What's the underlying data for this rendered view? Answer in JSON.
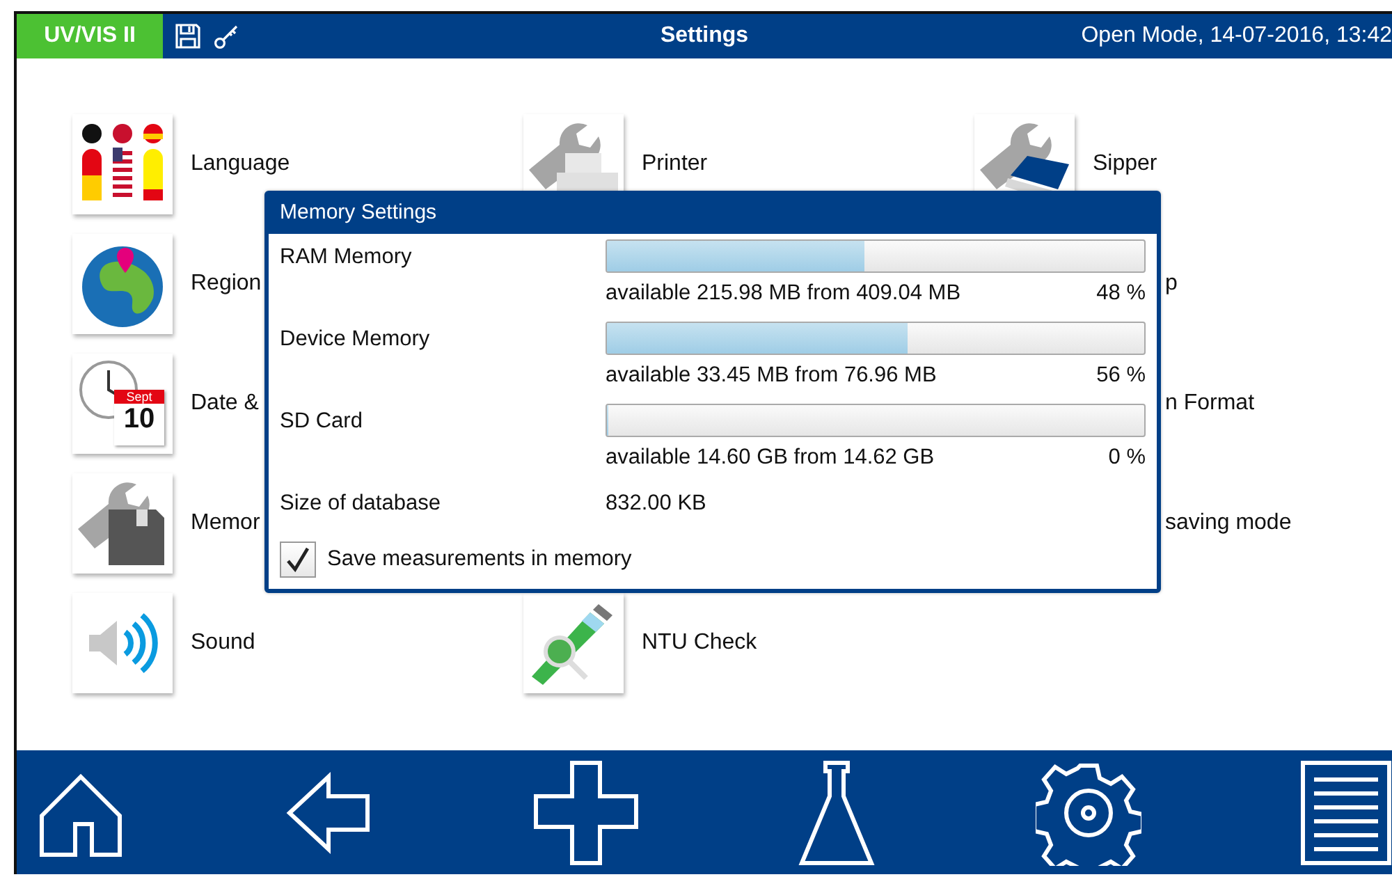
{
  "header": {
    "product": "UV/VIS II",
    "title": "Settings",
    "status": "Open Mode, 14-07-2016, 13:42"
  },
  "rows": [
    [
      {
        "label": "Language",
        "kind": "language"
      },
      {
        "label": "Printer",
        "kind": "printer"
      },
      {
        "label": "Sipper",
        "kind": "sipper"
      }
    ],
    [
      {
        "label": "Region",
        "kind": "globe"
      },
      null,
      {
        "label": "p"
      }
    ],
    [
      {
        "label": "Date &",
        "kind": "calendar",
        "calendar_month": "Sept",
        "calendar_day": "10"
      },
      null,
      {
        "label": "n Format"
      }
    ],
    [
      {
        "label": "Memor",
        "kind": "memory"
      },
      null,
      {
        "label": "saving mode"
      }
    ],
    [
      {
        "label": "Sound",
        "kind": "sound"
      },
      {
        "label": "NTU Check",
        "kind": "ntu"
      },
      null
    ]
  ],
  "dialog": {
    "title": "Memory Settings",
    "memories": [
      {
        "label": "RAM Memory",
        "level": 0.48,
        "available": "available 215.98 MB from 409.04 MB",
        "percent": "48 %"
      },
      {
        "label": "Device Memory",
        "level": 0.56,
        "available": "available 33.45 MB from 76.96 MB",
        "percent": "56 %"
      },
      {
        "label": "SD Card",
        "level": 0.0,
        "available": "available 14.60 GB from 14.62 GB",
        "percent": "0 %"
      }
    ],
    "database": {
      "label": "Size of database",
      "value": "832.00 KB"
    },
    "save_option": {
      "label": "Save measurements in memory",
      "checked": true
    }
  },
  "toolbar": [
    {
      "kind": "home"
    },
    {
      "kind": "back"
    },
    {
      "kind": "plus"
    },
    {
      "kind": "flask"
    },
    {
      "kind": "gear"
    },
    {
      "kind": "list"
    }
  ]
}
